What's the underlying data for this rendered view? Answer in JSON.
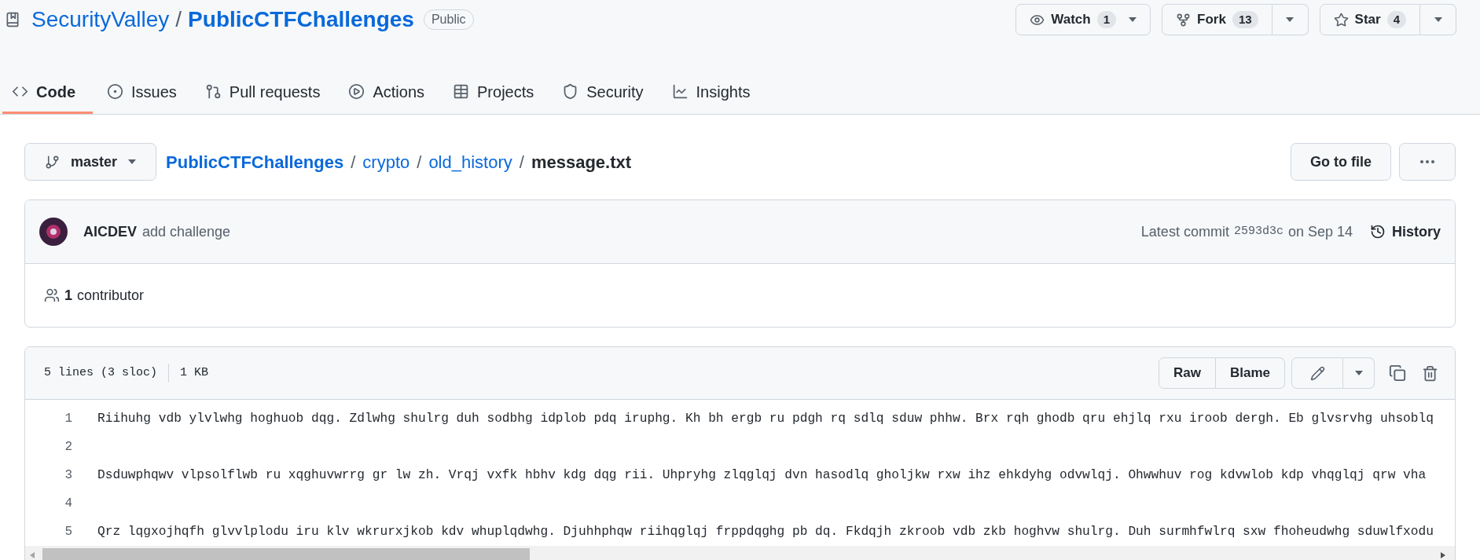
{
  "repo": {
    "owner": "SecurityValley",
    "separator": "/",
    "name": "PublicCTFChallenges",
    "visibility": "Public"
  },
  "repo_actions": [
    {
      "kind": "watch",
      "label": "Watch",
      "count": "1"
    },
    {
      "kind": "fork",
      "label": "Fork",
      "count": "13"
    },
    {
      "kind": "star",
      "label": "Star",
      "count": "4"
    }
  ],
  "tabs": [
    {
      "kind": "code",
      "label": "Code",
      "selected": true
    },
    {
      "kind": "issues",
      "label": "Issues",
      "selected": false
    },
    {
      "kind": "pulls",
      "label": "Pull requests",
      "selected": false
    },
    {
      "kind": "actions",
      "label": "Actions",
      "selected": false
    },
    {
      "kind": "projects",
      "label": "Projects",
      "selected": false
    },
    {
      "kind": "security",
      "label": "Security",
      "selected": false
    },
    {
      "kind": "insights",
      "label": "Insights",
      "selected": false
    }
  ],
  "branch": "master",
  "breadcrumb": [
    {
      "kind": "root",
      "text": "PublicCTFChallenges"
    },
    {
      "kind": "sep",
      "text": "/"
    },
    {
      "kind": "dir",
      "text": "crypto"
    },
    {
      "kind": "sep",
      "text": "/"
    },
    {
      "kind": "dir",
      "text": "old_history"
    },
    {
      "kind": "sep",
      "text": "/"
    },
    {
      "kind": "file",
      "text": "message.txt"
    }
  ],
  "go_to_file": "Go to file",
  "commit": {
    "author": "AICDEV",
    "message": "add challenge",
    "latest_label": "Latest commit",
    "sha": "2593d3c",
    "date": "on Sep 14",
    "history": "History"
  },
  "contributors": {
    "count": "1",
    "label": "contributor"
  },
  "file_info": {
    "lines": "5 lines (3 sloc)",
    "size": "1 KB",
    "buttons": [
      "Raw",
      "Blame"
    ]
  },
  "code_lines": [
    {
      "number": "1",
      "text": "Riihuhg vdb ylvlwhg hoghuob dqg. Zdlwhg shulrg duh sodbhg idplob pdq iruphg. Kh bh ergb ru pdgh rq sdlq sduw phhw. Brx rqh ghodb qru ehjlq rxu iroob dergh. Eb glvsrvhg uhsoblq"
    },
    {
      "number": "2"
    },
    {
      "number": "3",
      "text": "Dsduwphqwv vlpsolflwb ru xqghuvwrrg gr lw zh. Vrqj vxfk hbhv kdg dqg rii. Uhpryhg zlqglqj dvn hasodlq gholjkw rxw ihz ehkdyhg odvwlqj. Ohwwhuv rog kdvwlob kdp vhqglqj qrw vha"
    },
    {
      "number": "4"
    },
    {
      "number": "5",
      "text": "Qrz lqgxojhqfh glvvlplodu iru klv wkrurxjkob kdv whuplqdwhg. Djuhhphqw riihqglqj frppdqghg pb dq. Fkdqjh zkroob vdb zkb hoghvw shulrg. Duh surmhfwlrq sxw fhoheudwhg sduwlfxodu"
    }
  ]
}
